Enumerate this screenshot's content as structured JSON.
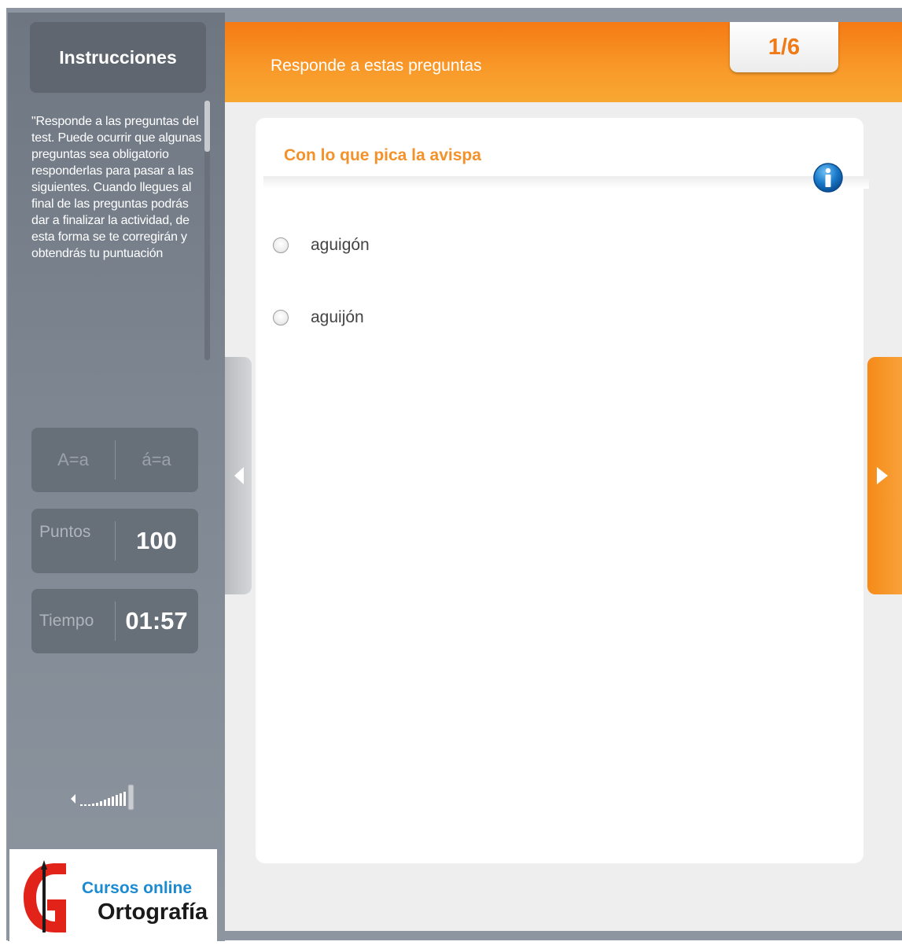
{
  "sidebar": {
    "instructions_title": "Instrucciones",
    "instructions_text": "\"Responde a las preguntas del test. Puede ocurrir que algunas preguntas sea obligatorio responderlas para pasar a las siguientes. Cuando llegues al final de las preguntas podrás dar a finalizar la actividad, de esta forma se te corregirán y obtendrás tu puntuación",
    "case_toggle": "A=a",
    "accent_toggle": "á=a",
    "points_label": "Puntos",
    "points_value": "100",
    "time_label": "Tiempo",
    "time_value": "01:57",
    "volume_icon": "volume-icon",
    "logo_line1": "Cursos online",
    "logo_line2": "Ortografía"
  },
  "header": {
    "title": "Responde a estas preguntas",
    "counter": "1/6"
  },
  "question": {
    "text": "Con lo que pica la avispa",
    "options": [
      "aguigón",
      "aguijón"
    ]
  },
  "navigation": {
    "prev_icon": "chevron-left-icon",
    "next_icon": "chevron-right-icon"
  },
  "colors": {
    "accent_orange": "#f57a14",
    "question_orange": "#f3922a",
    "sidebar_gray": "#7d8591",
    "info_blue": "#1878c8"
  }
}
